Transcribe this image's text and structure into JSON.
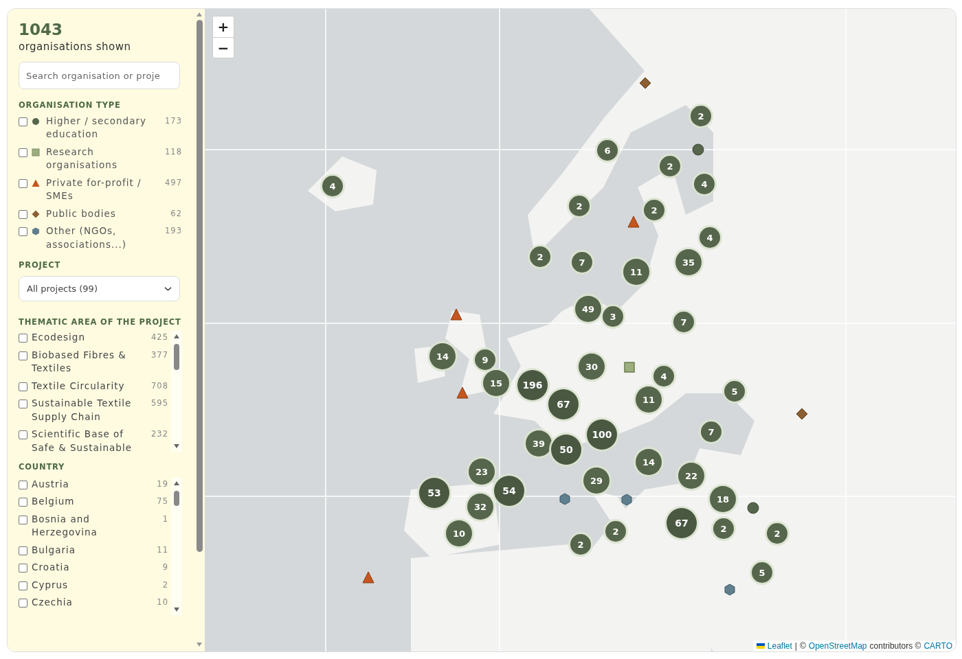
{
  "summary": {
    "count": "1043",
    "label": "organisations shown"
  },
  "search": {
    "placeholder": "Search organisation or proje"
  },
  "organisation_type": {
    "title": "ORGANISATION TYPE",
    "items": [
      {
        "label": "Higher / secondary education",
        "count": "173",
        "checked": false,
        "kind": "circle"
      },
      {
        "label": "Research organisations",
        "count": "118",
        "checked": false,
        "kind": "square"
      },
      {
        "label": "Private for-profit / SMEs",
        "count": "497",
        "checked": false,
        "kind": "triangle"
      },
      {
        "label": "Public bodies",
        "count": "62",
        "checked": false,
        "kind": "diamond"
      },
      {
        "label": "Other (NGOs, associations...)",
        "count": "193",
        "checked": false,
        "kind": "hexagon"
      }
    ]
  },
  "project": {
    "title": "PROJECT",
    "value": "All projects (99)"
  },
  "thematic_area": {
    "title": "THEMATIC AREA OF THE PROJECT",
    "items": [
      {
        "label": "Ecodesign",
        "count": "425",
        "checked": false
      },
      {
        "label": "Biobased Fibres & Textiles",
        "count": "377",
        "checked": false
      },
      {
        "label": "Textile Circularity",
        "count": "708",
        "checked": false
      },
      {
        "label": "Sustainable Textile Supply Chain",
        "count": "595",
        "checked": false
      },
      {
        "label": "Scientific Base of Safe & Sustainable",
        "count": "232",
        "checked": false
      }
    ]
  },
  "country": {
    "title": "COUNTRY",
    "items": [
      {
        "label": "Austria",
        "count": "19",
        "checked": false
      },
      {
        "label": "Belgium",
        "count": "75",
        "checked": false
      },
      {
        "label": "Bosnia and Herzegovina",
        "count": "1",
        "checked": false
      },
      {
        "label": "Bulgaria",
        "count": "11",
        "checked": false
      },
      {
        "label": "Croatia",
        "count": "9",
        "checked": false
      },
      {
        "label": "Cyprus",
        "count": "2",
        "checked": false
      },
      {
        "label": "Czechia",
        "count": "10",
        "checked": false
      }
    ]
  },
  "map": {
    "zoom_in": "+",
    "zoom_out": "−",
    "markers": [
      {
        "kind": "diamond"
      },
      {
        "kind": "cluster",
        "count": "2"
      },
      {
        "kind": "cluster",
        "count": "6"
      },
      {
        "kind": "circle"
      },
      {
        "kind": "cluster",
        "count": "2"
      },
      {
        "kind": "cluster",
        "count": "4"
      },
      {
        "kind": "cluster",
        "count": "4"
      },
      {
        "kind": "cluster",
        "count": "2"
      },
      {
        "kind": "cluster",
        "count": "2"
      },
      {
        "kind": "triangle"
      },
      {
        "kind": "cluster",
        "count": "4"
      },
      {
        "kind": "cluster",
        "count": "2"
      },
      {
        "kind": "cluster",
        "count": "7"
      },
      {
        "kind": "cluster",
        "count": "35"
      },
      {
        "kind": "cluster",
        "count": "11"
      },
      {
        "kind": "triangle"
      },
      {
        "kind": "cluster",
        "count": "49"
      },
      {
        "kind": "cluster",
        "count": "3"
      },
      {
        "kind": "cluster",
        "count": "7"
      },
      {
        "kind": "cluster",
        "count": "14"
      },
      {
        "kind": "cluster",
        "count": "9"
      },
      {
        "kind": "cluster",
        "count": "30"
      },
      {
        "kind": "square"
      },
      {
        "kind": "cluster",
        "count": "4"
      },
      {
        "kind": "triangle"
      },
      {
        "kind": "cluster",
        "count": "15"
      },
      {
        "kind": "cluster",
        "count": "196"
      },
      {
        "kind": "cluster",
        "count": "5"
      },
      {
        "kind": "cluster",
        "count": "67"
      },
      {
        "kind": "cluster",
        "count": "11"
      },
      {
        "kind": "diamond"
      },
      {
        "kind": "cluster",
        "count": "100"
      },
      {
        "kind": "cluster",
        "count": "7"
      },
      {
        "kind": "cluster",
        "count": "39"
      },
      {
        "kind": "cluster",
        "count": "50"
      },
      {
        "kind": "cluster",
        "count": "14"
      },
      {
        "kind": "cluster",
        "count": "23"
      },
      {
        "kind": "cluster",
        "count": "29"
      },
      {
        "kind": "cluster",
        "count": "22"
      },
      {
        "kind": "cluster",
        "count": "53"
      },
      {
        "kind": "cluster",
        "count": "54"
      },
      {
        "kind": "hexagon"
      },
      {
        "kind": "hexagon"
      },
      {
        "kind": "cluster",
        "count": "18"
      },
      {
        "kind": "cluster",
        "count": "32"
      },
      {
        "kind": "circle"
      },
      {
        "kind": "cluster",
        "count": "67"
      },
      {
        "kind": "cluster",
        "count": "10"
      },
      {
        "kind": "cluster",
        "count": "2"
      },
      {
        "kind": "cluster",
        "count": "2"
      },
      {
        "kind": "cluster",
        "count": "2"
      },
      {
        "kind": "cluster",
        "count": "2"
      },
      {
        "kind": "cluster",
        "count": "5"
      },
      {
        "kind": "triangle"
      },
      {
        "kind": "hexagon"
      }
    ],
    "attribution": [
      {
        "kind": "link",
        "text": "Leaflet"
      },
      {
        "kind": "text",
        "text": "|"
      },
      {
        "kind": "text",
        "text": "©"
      },
      {
        "kind": "link",
        "text": "OpenStreetMap"
      },
      {
        "kind": "text",
        "text": "contributors ©"
      },
      {
        "kind": "link",
        "text": "CARTO"
      }
    ]
  }
}
